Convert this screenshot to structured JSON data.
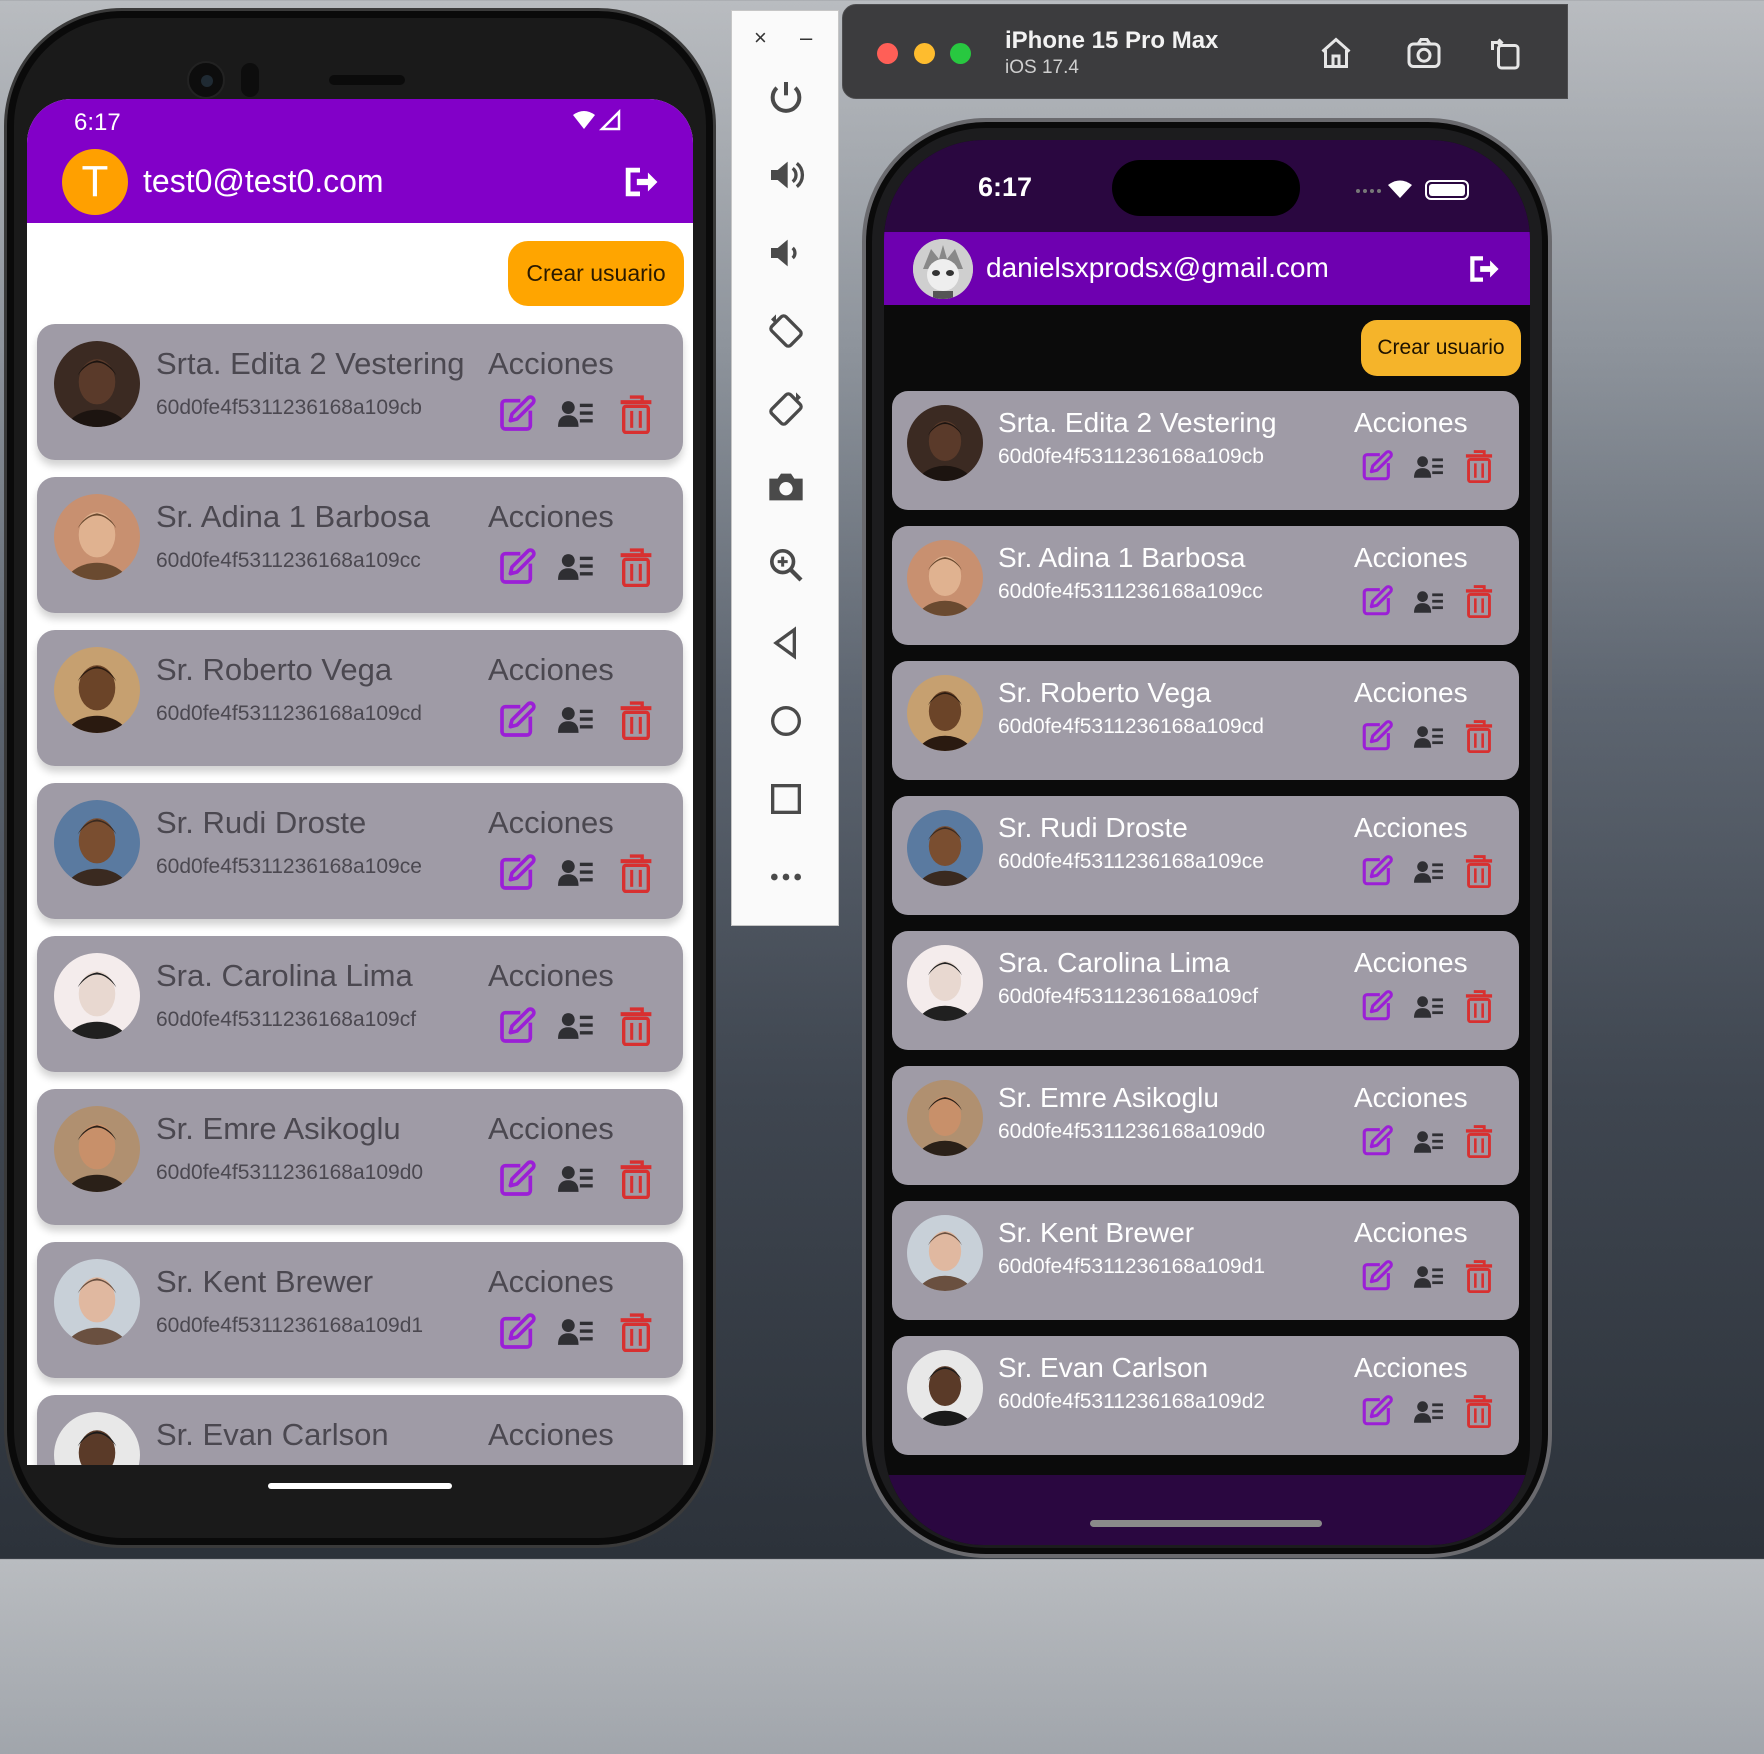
{
  "android": {
    "status_time": "6:17",
    "user_initial": "T",
    "user_email": "test0@test0.com",
    "create_button": "Crear usuario",
    "users": [
      {
        "name": "Srta. Edita 2 Vestering",
        "id": "60d0fe4f5311236168a109cb",
        "actions": "Acciones",
        "avatar": "avatar-edita"
      },
      {
        "name": "Sr. Adina 1 Barbosa",
        "id": "60d0fe4f5311236168a109cc",
        "actions": "Acciones",
        "avatar": "avatar-adina"
      },
      {
        "name": "Sr. Roberto Vega",
        "id": "60d0fe4f5311236168a109cd",
        "actions": "Acciones",
        "avatar": "avatar-roberto"
      },
      {
        "name": "Sr. Rudi Droste",
        "id": "60d0fe4f5311236168a109ce",
        "actions": "Acciones",
        "avatar": "avatar-rudi"
      },
      {
        "name": "Sra. Carolina Lima",
        "id": "60d0fe4f5311236168a109cf",
        "actions": "Acciones",
        "avatar": "avatar-carolina"
      },
      {
        "name": "Sr. Emre Asikoglu",
        "id": "60d0fe4f5311236168a109d0",
        "actions": "Acciones",
        "avatar": "avatar-emre"
      },
      {
        "name": "Sr. Kent Brewer",
        "id": "60d0fe4f5311236168a109d1",
        "actions": "Acciones",
        "avatar": "avatar-kent"
      },
      {
        "name": "Sr. Evan Carlson",
        "id": "",
        "actions": "Acciones",
        "avatar": "avatar-evan"
      }
    ]
  },
  "emulator_toolbar": {
    "close": "×",
    "minimize": "–",
    "buttons": [
      "power-icon",
      "volume-up-icon",
      "volume-down-icon",
      "rotate-left-icon",
      "rotate-right-icon",
      "camera-icon",
      "zoom-icon",
      "back-icon",
      "home-icon",
      "overview-icon",
      "more-icon"
    ]
  },
  "simulator": {
    "device_name": "iPhone 15 Pro Max",
    "os_version": "iOS 17.4",
    "status_time": "6:17",
    "user_email": "danielsxprodsx@gmail.com",
    "create_button": "Crear usuario",
    "users": [
      {
        "name": "Srta. Edita 2 Vestering",
        "id": "60d0fe4f5311236168a109cb",
        "actions": "Acciones"
      },
      {
        "name": "Sr. Adina 1 Barbosa",
        "id": "60d0fe4f5311236168a109cc",
        "actions": "Acciones"
      },
      {
        "name": "Sr. Roberto Vega",
        "id": "60d0fe4f5311236168a109cd",
        "actions": "Acciones"
      },
      {
        "name": "Sr. Rudi Droste",
        "id": "60d0fe4f5311236168a109ce",
        "actions": "Acciones"
      },
      {
        "name": "Sra. Carolina Lima",
        "id": "60d0fe4f5311236168a109cf",
        "actions": "Acciones"
      },
      {
        "name": "Sr. Emre Asikoglu",
        "id": "60d0fe4f5311236168a109d0",
        "actions": "Acciones"
      },
      {
        "name": "Sr. Kent Brewer",
        "id": "60d0fe4f5311236168a109d1",
        "actions": "Acciones"
      },
      {
        "name": "Sr. Evan Carlson",
        "id": "60d0fe4f5311236168a109d2",
        "actions": "Acciones"
      }
    ]
  },
  "colors": {
    "android_appbar": "#8200c8",
    "ios_appbar": "#6e00b0",
    "card": "#9f9ba6",
    "accent_orange": "#ffa500",
    "edit_icon": "#9b1fd6",
    "delete_icon": "#d83030"
  }
}
